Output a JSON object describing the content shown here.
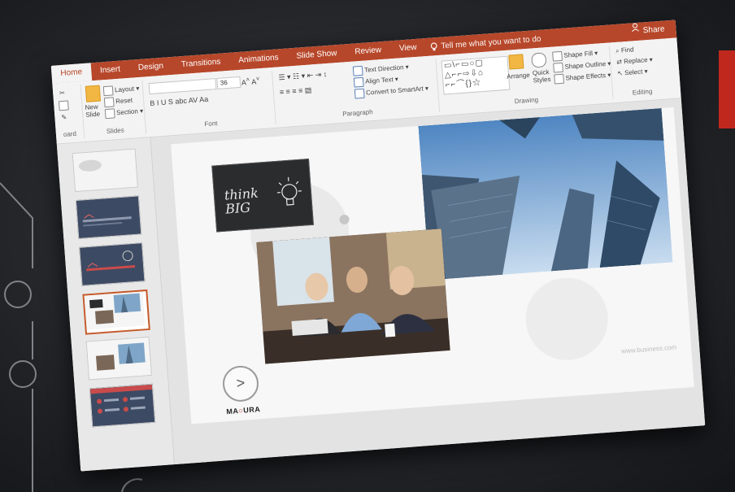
{
  "colors": {
    "ribbon_accent": "#b7472a",
    "selection": "#c55a2a",
    "brand_red": "#c0281e"
  },
  "tabs": [
    "Home",
    "Insert",
    "Design",
    "Transitions",
    "Animations",
    "Slide Show",
    "Review",
    "View"
  ],
  "tell_me": {
    "icon": "lightbulb-icon",
    "text": "Tell me what you want to do"
  },
  "share": {
    "icon": "person-icon",
    "label": "Share"
  },
  "ribbon": {
    "clipboard_label": "oard",
    "slides": {
      "new_slide": "New\nSlide",
      "layout": "Layout",
      "reset": "Reset",
      "section": "Section",
      "label": "Slides"
    },
    "font": {
      "font_size": "36",
      "format_buttons": "B  I  U  S  abc  AV  Aa",
      "label": "Font"
    },
    "paragraph": {
      "text_direction": "Text Direction",
      "align_text": "Align Text",
      "smartart": "Convert to SmartArt",
      "label": "Paragraph"
    },
    "drawing": {
      "shape_symbols": "▭\\⌐▭○▢\n△⌐⌐⇨⇩⌂\n⌐⌐⌒{}☆",
      "arrange": "Arrange",
      "quick_styles": "Quick\nStyles",
      "shape_fill": "Shape Fill",
      "shape_outline": "Shape Outline",
      "shape_effects": "Shape Effects",
      "label": "Drawing"
    },
    "editing": {
      "find": "Find",
      "replace": "Replace",
      "select": "Select",
      "label": "Editing"
    }
  },
  "slide": {
    "chalk_text": "think\nBIG",
    "next_symbol": ">",
    "brand_prefix": "MA",
    "brand_mark": "○",
    "brand_suffix": "URA",
    "website": "www.business.com"
  }
}
